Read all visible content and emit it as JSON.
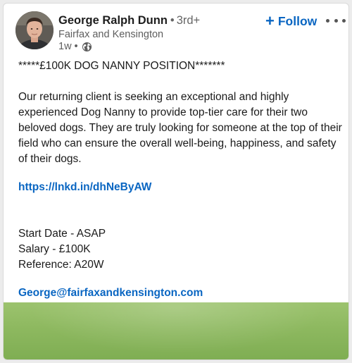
{
  "author": {
    "name": "George Ralph Dunn",
    "separator": "•",
    "degree": "3rd+",
    "company": "Fairfax and Kensington",
    "time": "1w",
    "time_separator": "•",
    "visibility_icon": "globe-icon"
  },
  "actions": {
    "follow_plus": "+",
    "follow_label": "Follow",
    "more_icon": "ellipsis-icon"
  },
  "post": {
    "headline": "*****£100K DOG NANNY POSITION*******",
    "paragraph": "Our returning client is seeking an exceptional and highly experienced Dog Nanny to provide top-tier care for their two beloved dogs. They are truly looking for someone at the top of their field  who can ensure the overall well-being, happiness, and safety of their dogs.",
    "link": "https://lnkd.in/dhNeByAW",
    "start_date": "Start Date - ASAP",
    "salary": "Salary - £100K",
    "reference": "Reference: A20W",
    "email": "George@fairfaxandkensington.com"
  },
  "colors": {
    "link": "#0a66c2",
    "text": "#1a1a1a",
    "muted": "#5e5e5e",
    "media_green": "#8db85f"
  }
}
